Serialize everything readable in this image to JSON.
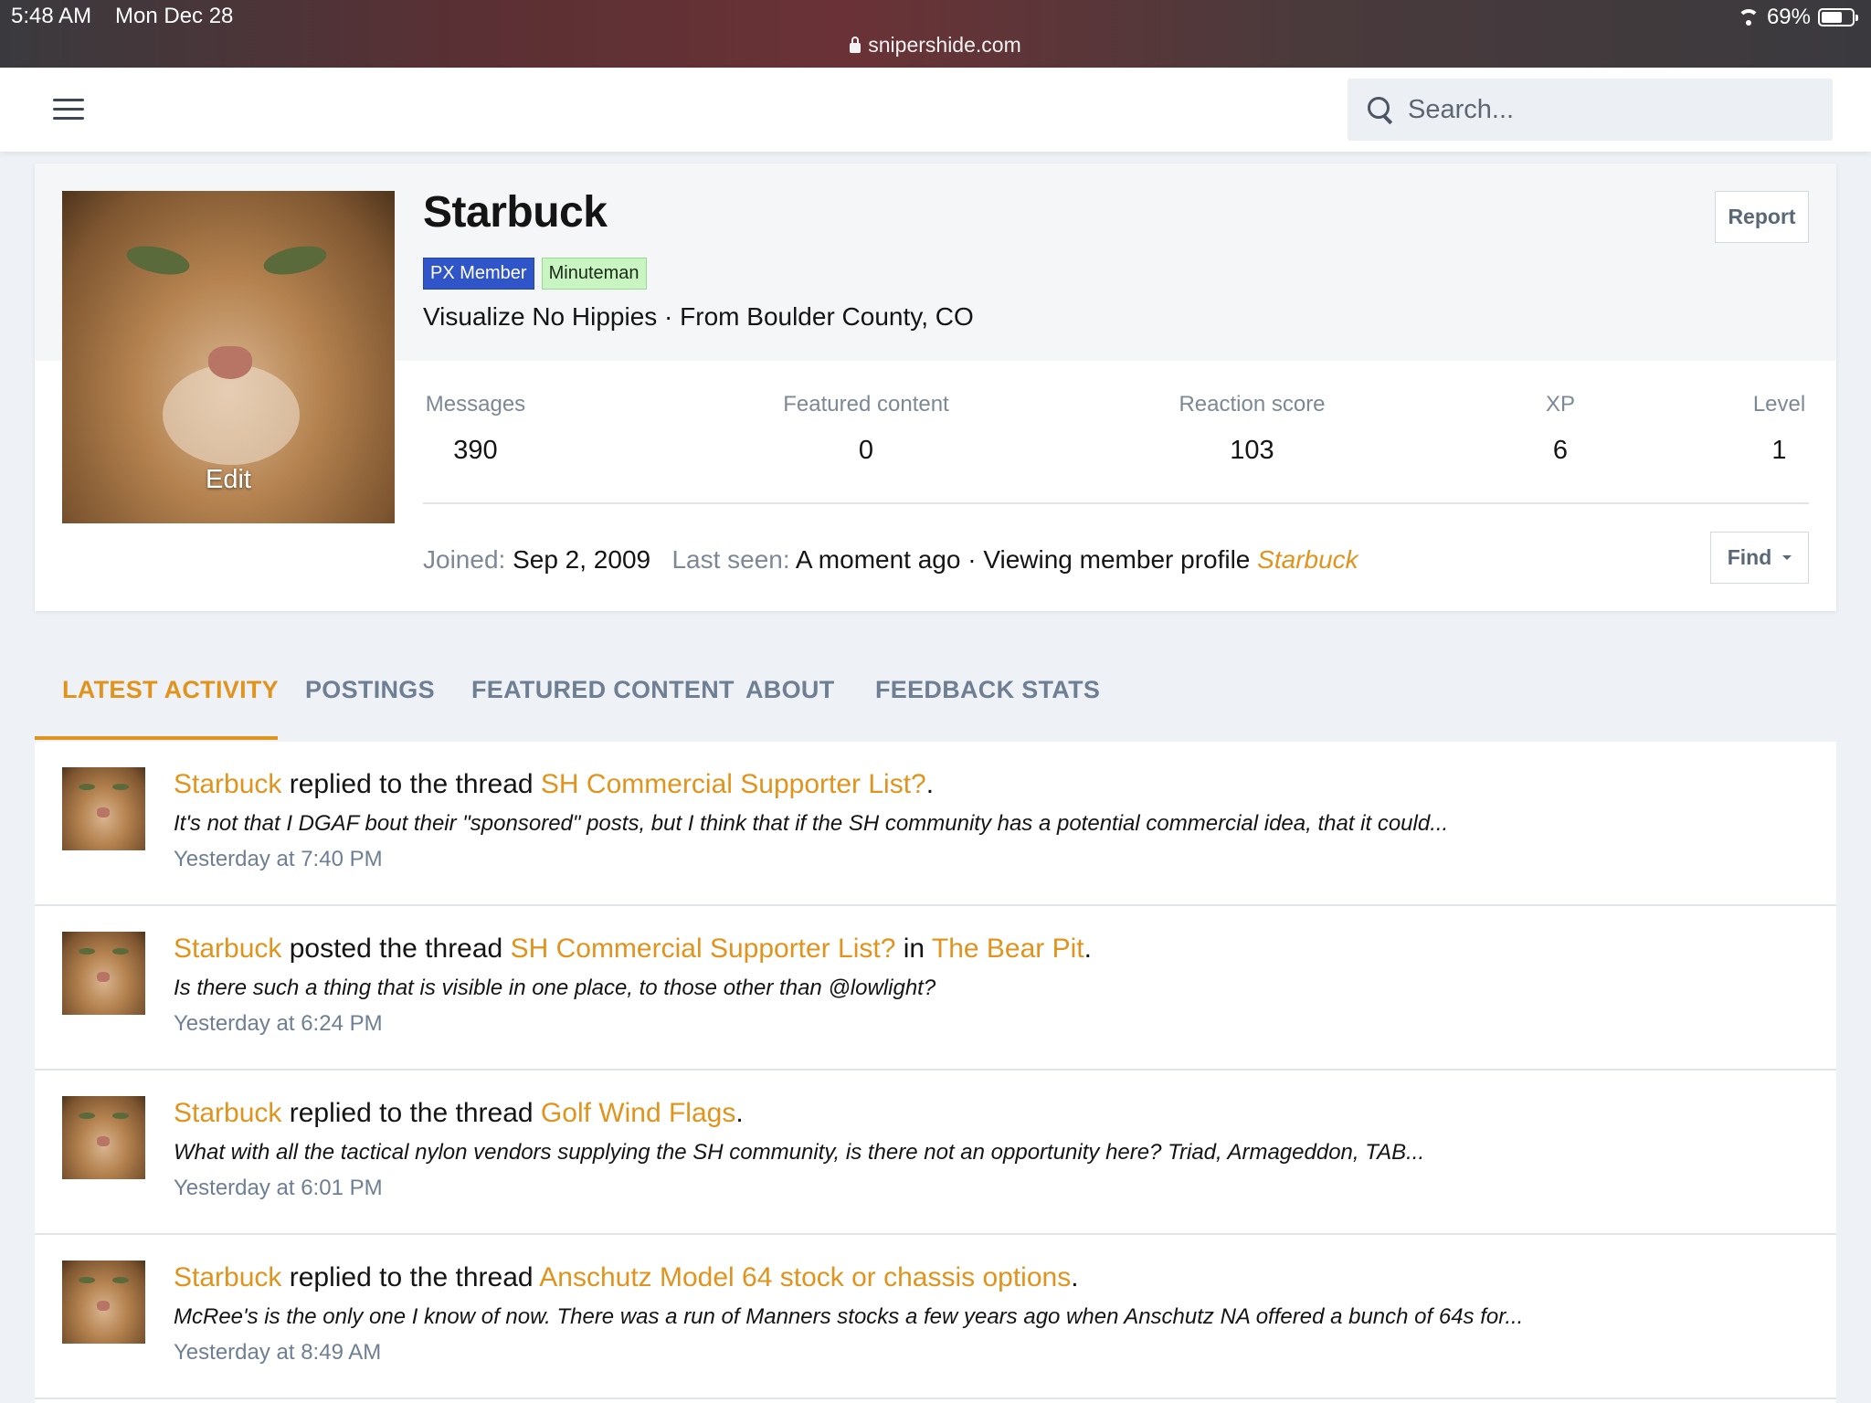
{
  "status_bar": {
    "time": "5:48 AM",
    "date": "Mon Dec 28",
    "url": "snipershide.com",
    "battery": "69%",
    "battery_level": 0.69
  },
  "header": {
    "search_placeholder": "Search..."
  },
  "profile": {
    "username": "Starbuck",
    "badges": [
      "PX Member",
      "Minuteman"
    ],
    "tagline": "Visualize No Hippies · From Boulder County, CO",
    "avatar_edit": "Edit",
    "report_label": "Report",
    "stats": [
      {
        "label": "Messages",
        "value": "390"
      },
      {
        "label": "Featured content",
        "value": "0"
      },
      {
        "label": "Reaction score",
        "value": "103"
      },
      {
        "label": "XP",
        "value": "6"
      },
      {
        "label": "Level",
        "value": "1"
      }
    ],
    "joined_label": "Joined:",
    "joined_value": "Sep 2, 2009",
    "last_seen_label": "Last seen:",
    "last_seen_value": "A moment ago · Viewing member profile",
    "last_seen_link": "Starbuck",
    "find_label": "Find"
  },
  "tabs": [
    "LATEST ACTIVITY",
    "POSTINGS",
    "FEATURED CONTENT",
    "ABOUT",
    "FEEDBACK STATS"
  ],
  "activity": [
    {
      "user": "Starbuck",
      "action": " replied to the thread ",
      "thread": "SH Commercial Supporter List?",
      "forum_prefix": "",
      "forum": "",
      "end": ".",
      "snippet": "It's not that I DGAF bout their \"sponsored\" posts, but I think that if the SH community has a potential commercial idea, that it could...",
      "time": "Yesterday at 7:40 PM"
    },
    {
      "user": "Starbuck",
      "action": " posted the thread ",
      "thread": "SH Commercial Supporter List?",
      "forum_prefix": " in ",
      "forum": "The Bear Pit",
      "end": ".",
      "snippet": "Is there such a thing that is visible in one place, to those other than @lowlight?",
      "time": "Yesterday at 6:24 PM"
    },
    {
      "user": "Starbuck",
      "action": " replied to the thread ",
      "thread": "Golf Wind Flags",
      "forum_prefix": "",
      "forum": "",
      "end": ".",
      "snippet": "What with all the tactical nylon vendors supplying the SH community, is there not an opportunity here? Triad, Armageddon, TAB...",
      "time": "Yesterday at 6:01 PM"
    },
    {
      "user": "Starbuck",
      "action": " replied to the thread ",
      "thread": "Anschutz Model 64 stock or chassis options",
      "forum_prefix": "",
      "forum": "",
      "end": ".",
      "snippet": "McRee's is the only one I know of now. There was a run of Manners stocks a few years ago when Anschutz NA offered a bunch of 64s for...",
      "time": "Yesterday at 8:49 AM"
    }
  ],
  "colors": {
    "accent": "#e0941d",
    "px_member_badge": "#2f55c8",
    "minuteman_badge": "#c9f5c3",
    "muted_text": "#7d8896"
  },
  "icons": [
    "lock-icon",
    "wifi-icon",
    "battery-icon",
    "hamburger-menu-icon",
    "search-icon",
    "caret-down-icon"
  ]
}
